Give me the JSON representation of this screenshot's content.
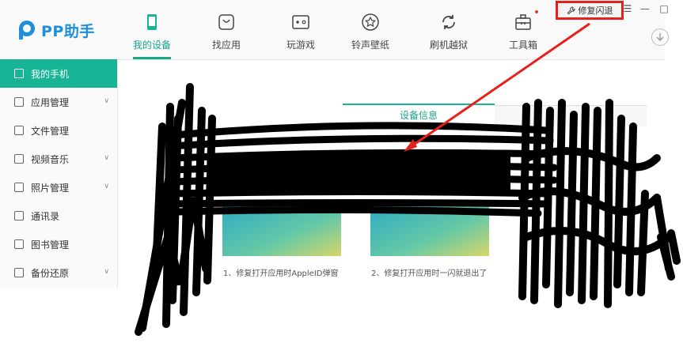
{
  "app": {
    "name": "PP助手"
  },
  "nav": [
    {
      "label": "我的设备",
      "icon": "phone-icon",
      "active": true
    },
    {
      "label": "找应用",
      "icon": "app-store-icon",
      "active": false
    },
    {
      "label": "玩游戏",
      "icon": "gamepad-icon",
      "active": false
    },
    {
      "label": "铃声壁纸",
      "icon": "star-icon",
      "active": false
    },
    {
      "label": "刷机越狱",
      "icon": "refresh-icon",
      "active": false
    },
    {
      "label": "工具箱",
      "icon": "toolbox-icon",
      "active": false
    }
  ],
  "topbar": {
    "repair_label": "修复闪退"
  },
  "window_controls": {
    "menu": "☰",
    "minimize": "—",
    "maximize": "□"
  },
  "sidebar": {
    "items": [
      {
        "label": "我的手机",
        "active": true,
        "has_chevron": false
      },
      {
        "label": "应用管理",
        "active": false,
        "has_chevron": true
      },
      {
        "label": "文件管理",
        "active": false,
        "has_chevron": false
      },
      {
        "label": "视频音乐",
        "active": false,
        "has_chevron": true
      },
      {
        "label": "照片管理",
        "active": false,
        "has_chevron": true
      },
      {
        "label": "通讯录",
        "active": false,
        "has_chevron": false
      },
      {
        "label": "图书管理",
        "active": false,
        "has_chevron": false
      },
      {
        "label": "备份还原",
        "active": false,
        "has_chevron": true
      }
    ]
  },
  "main": {
    "tab_info": "设备信息",
    "tips": [
      "1、修复打开应用时AppleID弹窗",
      "2、修复打开应用时一闪就退出了"
    ]
  },
  "colors": {
    "accent": "#17b596",
    "brand": "#1f8fd8",
    "highlight": "#e8201a"
  }
}
